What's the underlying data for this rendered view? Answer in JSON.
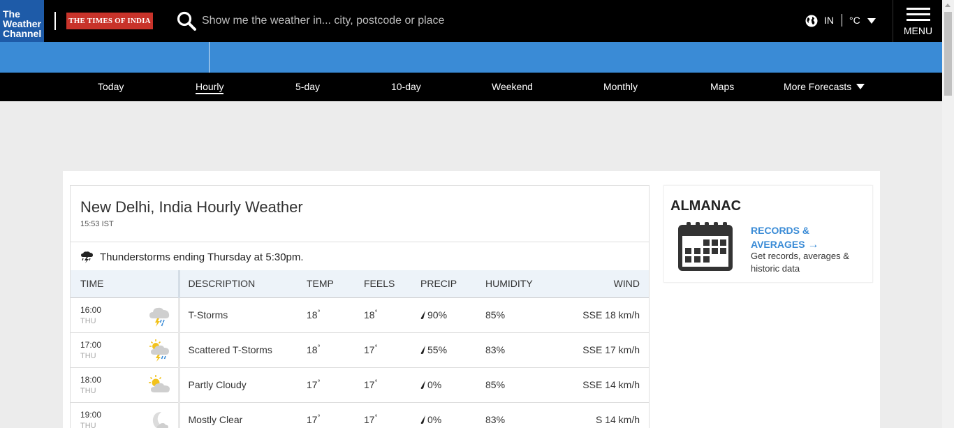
{
  "header": {
    "twc_logo": [
      "The",
      "Weather",
      "Channel"
    ],
    "partner_logo": "THE TIMES OF INDIA",
    "search": {
      "placeholder": "Show me the weather in... city, postcode or place"
    },
    "region": "IN",
    "unit": "°C",
    "menu_label": "MENU"
  },
  "nav": {
    "items": [
      {
        "label": "Today"
      },
      {
        "label": "Hourly",
        "active": true
      },
      {
        "label": "5-day"
      },
      {
        "label": "10-day"
      },
      {
        "label": "Weekend"
      },
      {
        "label": "Monthly"
      },
      {
        "label": "Maps"
      },
      {
        "label": "More Forecasts"
      }
    ]
  },
  "hourly": {
    "title": "New Delhi, India Hourly Weather",
    "time": "15:53 IST",
    "alert": "Thunderstorms ending Thursday at 5:30pm.",
    "columns": [
      "TIME",
      "DESCRIPTION",
      "TEMP",
      "FEELS",
      "PRECIP",
      "HUMIDITY",
      "WIND"
    ],
    "rows": [
      {
        "time": "16:00",
        "day": "THU",
        "icon": "thunderstorm-icon",
        "desc": "T-Storms",
        "temp": "18",
        "feels": "18",
        "precip": "90%",
        "humidity": "85%",
        "wind": "SSE 18 km/h"
      },
      {
        "time": "17:00",
        "day": "THU",
        "icon": "scattered-thunderstorm-icon",
        "desc": "Scattered T-Storms",
        "temp": "18",
        "feels": "17",
        "precip": "55%",
        "humidity": "83%",
        "wind": "SSE 17 km/h"
      },
      {
        "time": "18:00",
        "day": "THU",
        "icon": "partly-cloudy-icon",
        "desc": "Partly Cloudy",
        "temp": "17",
        "feels": "17",
        "precip": "0%",
        "humidity": "85%",
        "wind": "SSE 14 km/h"
      },
      {
        "time": "19:00",
        "day": "THU",
        "icon": "mostly-clear-night-icon",
        "desc": "Mostly Clear",
        "temp": "17",
        "feels": "17",
        "precip": "0%",
        "humidity": "83%",
        "wind": "S 14 km/h"
      }
    ],
    "degree_symbol": "°"
  },
  "almanac": {
    "title": "ALMANAC",
    "link_line1": "RECORDS &",
    "link_line2": "AVERAGES",
    "link_arrow": "→",
    "description": "Get records, averages & historic data"
  },
  "colors": {
    "header_bg": "#000000",
    "twc_blue": "#1e5ba8",
    "band_blue": "#3a8bd6",
    "toi_red": "#c8332a",
    "table_header_bg": "#edf3f9"
  }
}
